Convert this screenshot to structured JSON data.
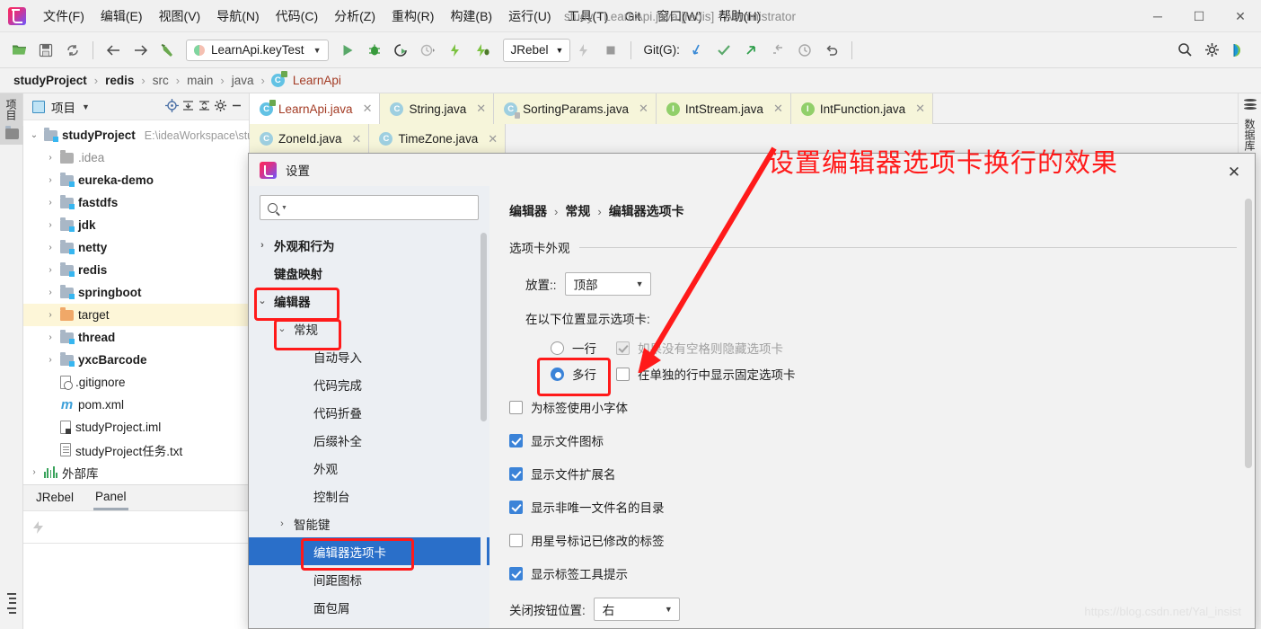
{
  "window": {
    "title": "study - LearnApi.java [redis] - Administrator",
    "minimize": "─",
    "maximize": "☐",
    "close": "✕"
  },
  "menu": [
    {
      "label": "文件(F)"
    },
    {
      "label": "编辑(E)"
    },
    {
      "label": "视图(V)"
    },
    {
      "label": "导航(N)"
    },
    {
      "label": "代码(C)"
    },
    {
      "label": "分析(Z)"
    },
    {
      "label": "重构(R)"
    },
    {
      "label": "构建(B)"
    },
    {
      "label": "运行(U)"
    },
    {
      "label": "工具(T)"
    },
    {
      "label": "Git"
    },
    {
      "label": "窗口(W)"
    },
    {
      "label": "帮助(H)"
    }
  ],
  "toolbar": {
    "run_config": "LearnApi.keyTest",
    "jrebel": "JRebel",
    "git_label": "Git(G):"
  },
  "breadcrumb": {
    "items": [
      "studyProject",
      "redis",
      "src",
      "main",
      "java",
      "LearnApi"
    ],
    "separator": "›"
  },
  "left_rail": {
    "project_tab": "项目"
  },
  "right_rail": {
    "database_tab": "数据库"
  },
  "project_panel": {
    "title": "项目",
    "tree": [
      {
        "label": "studyProject",
        "path": "E:\\ideaWorkspace\\studyProject",
        "icon": "folder-module",
        "arrow": "expanded",
        "indent": 0,
        "bold": true,
        "selected": false
      },
      {
        "label": ".idea",
        "path": "",
        "icon": "folder-plain",
        "arrow": "collapsed",
        "indent": 1,
        "bold": false,
        "grey": true,
        "selected": false
      },
      {
        "label": "eureka-demo",
        "path": "",
        "icon": "folder-module",
        "arrow": "collapsed",
        "indent": 1,
        "bold": true,
        "selected": false
      },
      {
        "label": "fastdfs",
        "path": "",
        "icon": "folder-module",
        "arrow": "collapsed",
        "indent": 1,
        "bold": true,
        "selected": false
      },
      {
        "label": "jdk",
        "path": "",
        "icon": "folder-module",
        "arrow": "collapsed",
        "indent": 1,
        "bold": true,
        "selected": false
      },
      {
        "label": "netty",
        "path": "",
        "icon": "folder-module",
        "arrow": "collapsed",
        "indent": 1,
        "bold": true,
        "selected": false
      },
      {
        "label": "redis",
        "path": "",
        "icon": "folder-module",
        "arrow": "collapsed",
        "indent": 1,
        "bold": true,
        "selected": false
      },
      {
        "label": "springboot",
        "path": "",
        "icon": "folder-module",
        "arrow": "collapsed",
        "indent": 1,
        "bold": true,
        "selected": false
      },
      {
        "label": "target",
        "path": "",
        "icon": "folder-orange",
        "arrow": "collapsed",
        "indent": 1,
        "bold": false,
        "selected": true
      },
      {
        "label": "thread",
        "path": "",
        "icon": "folder-module",
        "arrow": "collapsed",
        "indent": 1,
        "bold": true,
        "selected": false
      },
      {
        "label": "yxcBarcode",
        "path": "",
        "icon": "folder-module",
        "arrow": "collapsed",
        "indent": 1,
        "bold": true,
        "selected": false
      },
      {
        "label": ".gitignore",
        "path": "",
        "icon": "file-gitignore",
        "arrow": "none",
        "indent": 1,
        "bold": false,
        "selected": false
      },
      {
        "label": "pom.xml",
        "path": "",
        "icon": "file-maven",
        "arrow": "none",
        "indent": 1,
        "bold": false,
        "selected": false
      },
      {
        "label": "studyProject.iml",
        "path": "",
        "icon": "file-iml",
        "arrow": "none",
        "indent": 1,
        "bold": false,
        "selected": false
      },
      {
        "label": "studyProject任务.txt",
        "path": "",
        "icon": "file-text",
        "arrow": "none",
        "indent": 1,
        "bold": false,
        "selected": false
      },
      {
        "label": "外部库",
        "path": "",
        "icon": "library",
        "arrow": "collapsed",
        "indent": 0,
        "bold": false,
        "selected": false
      }
    ]
  },
  "jrebel_panel": {
    "tabs": [
      {
        "label": "JRebel",
        "active": false
      },
      {
        "label": "Panel",
        "active": true
      }
    ]
  },
  "editor_tabs": {
    "row1": [
      {
        "label": "LearnApi.java",
        "icon": "class-runnable",
        "active": true,
        "close": "✕"
      },
      {
        "label": "String.java",
        "icon": "class-readonly",
        "active": false,
        "close": "✕"
      },
      {
        "label": "SortingParams.java",
        "icon": "class-locked",
        "active": false,
        "close": "✕"
      },
      {
        "label": "IntStream.java",
        "icon": "interface",
        "active": false,
        "close": "✕"
      },
      {
        "label": "IntFunction.java",
        "icon": "interface",
        "active": false,
        "close": "✕"
      }
    ],
    "row2": [
      {
        "label": "ZoneId.java",
        "icon": "class-readonly",
        "active": false,
        "close": "✕"
      },
      {
        "label": "TimeZone.java",
        "icon": "class-readonly",
        "active": false,
        "close": "✕"
      }
    ]
  },
  "dialog": {
    "title": "设置",
    "close": "✕",
    "search_placeholder": "",
    "nav": [
      {
        "label": "外观和行为",
        "arrow": "collapsed",
        "indent": 0,
        "bold": true,
        "selected": false,
        "highlight": false
      },
      {
        "label": "键盘映射",
        "arrow": "none",
        "indent": 0,
        "bold": true,
        "selected": false,
        "highlight": false
      },
      {
        "label": "编辑器",
        "arrow": "expanded",
        "indent": 0,
        "bold": true,
        "selected": false,
        "highlight": true
      },
      {
        "label": "常规",
        "arrow": "expanded",
        "indent": 1,
        "bold": false,
        "selected": false,
        "highlight": true
      },
      {
        "label": "自动导入",
        "arrow": "none",
        "indent": 2,
        "bold": false,
        "selected": false,
        "highlight": false
      },
      {
        "label": "代码完成",
        "arrow": "none",
        "indent": 2,
        "bold": false,
        "selected": false,
        "highlight": false
      },
      {
        "label": "代码折叠",
        "arrow": "none",
        "indent": 2,
        "bold": false,
        "selected": false,
        "highlight": false
      },
      {
        "label": "后缀补全",
        "arrow": "none",
        "indent": 2,
        "bold": false,
        "selected": false,
        "highlight": false
      },
      {
        "label": "外观",
        "arrow": "none",
        "indent": 2,
        "bold": false,
        "selected": false,
        "highlight": false
      },
      {
        "label": "控制台",
        "arrow": "none",
        "indent": 2,
        "bold": false,
        "selected": false,
        "highlight": false
      },
      {
        "label": "智能键",
        "arrow": "collapsed",
        "indent": 1,
        "bold": false,
        "selected": false,
        "highlight": false
      },
      {
        "label": "编辑器选项卡",
        "arrow": "none",
        "indent": 2,
        "bold": false,
        "selected": true,
        "highlight": true
      },
      {
        "label": "间距图标",
        "arrow": "none",
        "indent": 2,
        "bold": false,
        "selected": false,
        "highlight": false
      },
      {
        "label": "面包屑",
        "arrow": "none",
        "indent": 2,
        "bold": false,
        "selected": false,
        "highlight": false
      }
    ],
    "breadcrumb": [
      "编辑器",
      "常规",
      "编辑器选项卡"
    ],
    "breadcrumb_sep": "›",
    "group_title": "选项卡外观",
    "placement_label": "放置::",
    "placement_value": "顶部",
    "show_tabs_in_label": "在以下位置显示选项卡:",
    "radio_one_row": "一行",
    "radio_multi_row": "多行",
    "radio_selected": "多行",
    "checkbox_hide_if_no_space": "如果没有空格则隐藏选项卡",
    "checkbox_pinned_separate_row": "在单独的行中显示固定选项卡",
    "checkboxes": [
      {
        "label": "为标签使用小字体",
        "checked": false,
        "disabled": false
      },
      {
        "label": "显示文件图标",
        "checked": true,
        "disabled": false
      },
      {
        "label": "显示文件扩展名",
        "checked": true,
        "disabled": false
      },
      {
        "label": "显示非唯一文件名的目录",
        "checked": true,
        "disabled": false
      },
      {
        "label": "用星号标记已修改的标签",
        "checked": false,
        "disabled": false
      },
      {
        "label": "显示标签工具提示",
        "checked": true,
        "disabled": false
      }
    ],
    "close_button_pos_label": "关闭按钮位置:",
    "close_button_pos_value": "右"
  },
  "annotation": {
    "text": "设置编辑器选项卡换行的效果",
    "color": "#ff1a1a"
  },
  "watermark": "https://blog.csdn.net/Yal_insist"
}
